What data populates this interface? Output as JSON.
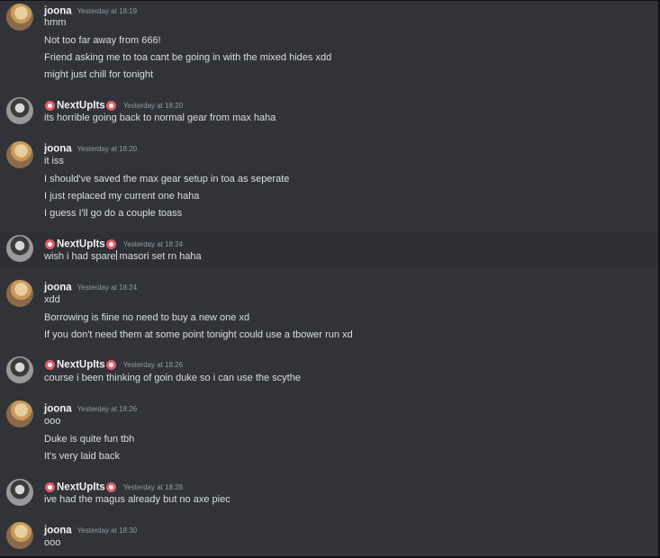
{
  "colors": {
    "background": "#313338",
    "highlight": "#2e3035",
    "username": "#f2f3f5",
    "timestamp": "#949ba4",
    "message": "#dbdee1",
    "badge": "#e35d6a"
  },
  "messages": [
    {
      "author": "joona",
      "timestamp": "Yesterday at 18:19",
      "lines": [
        "hmm",
        "Not too far away from 666!",
        "Friend asking me to toa cant be going in with the mixed hides xdd",
        "might just chill for tonight"
      ]
    },
    {
      "author": "NextUpIts",
      "timestamp": "Yesterday at 18:20",
      "lines": [
        "its horrible going back to normal gear from max haha"
      ]
    },
    {
      "author": "joona",
      "timestamp": "Yesterday at 18:20",
      "lines": [
        "it iss",
        "I should've saved the max gear setup in toa as seperate",
        "I just replaced my current one haha",
        "I guess I'll go do a couple toass"
      ]
    },
    {
      "author": "NextUpIts",
      "timestamp": "Yesterday at 18:24",
      "lines": [
        "wish i had spare masori set rn haha"
      ],
      "caret_before": "wish i had spare",
      "caret_after": " masori set rn haha"
    },
    {
      "author": "joona",
      "timestamp": "Yesterday at 18:24",
      "lines": [
        "xdd",
        "Borrowing is fiine no need to buy a new one xd",
        "If you don't need them at some point tonight could use a tbower run xd"
      ]
    },
    {
      "author": "NextUpIts",
      "timestamp": "Yesterday at 18:26",
      "lines": [
        "course i been thinking of goin duke so i can use the scythe"
      ]
    },
    {
      "author": "joona",
      "timestamp": "Yesterday at 18:26",
      "lines": [
        "ooo",
        "Duke is quite fun tbh",
        "It's very laid back"
      ]
    },
    {
      "author": "NextUpIts",
      "timestamp": "Yesterday at 18:28",
      "lines": [
        "ive had the magus already but no axe piec"
      ]
    },
    {
      "author": "joona",
      "timestamp": "Yesterday at 18:30",
      "lines": [
        "ooo"
      ]
    }
  ]
}
